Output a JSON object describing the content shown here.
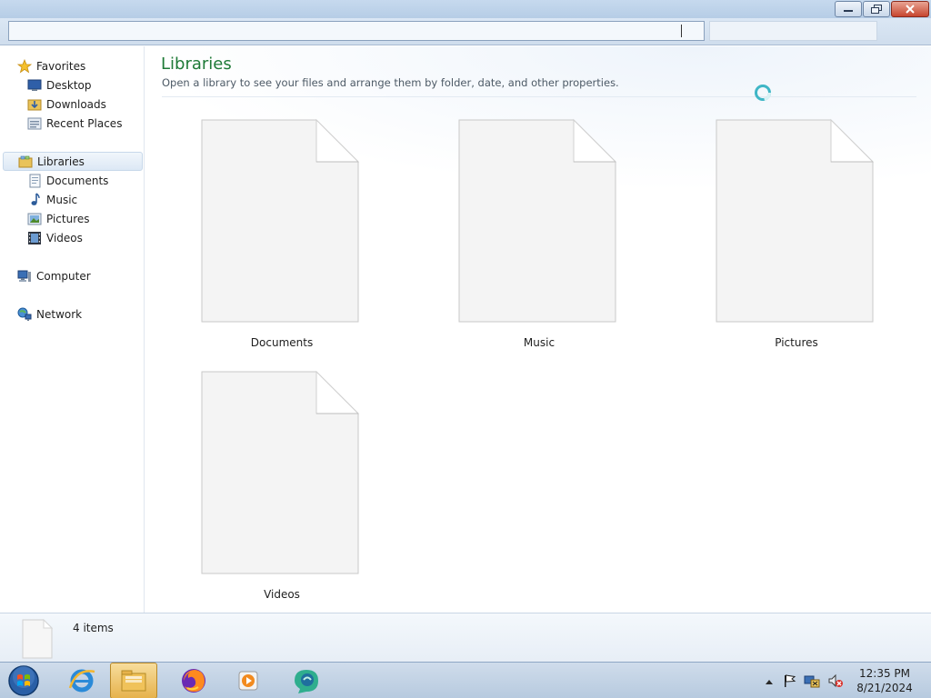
{
  "sidebar": {
    "favorites": {
      "label": "Favorites",
      "items": [
        "Desktop",
        "Downloads",
        "Recent Places"
      ]
    },
    "libraries": {
      "label": "Libraries",
      "items": [
        "Documents",
        "Music",
        "Pictures",
        "Videos"
      ]
    },
    "computer": {
      "label": "Computer"
    },
    "network": {
      "label": "Network"
    }
  },
  "main": {
    "title": "Libraries",
    "subtitle": "Open a library to see your files and arrange them by folder, date, and other properties.",
    "libraries": [
      {
        "label": "Documents"
      },
      {
        "label": "Music"
      },
      {
        "label": "Pictures"
      },
      {
        "label": "Videos"
      }
    ]
  },
  "details": {
    "count": "4 items"
  },
  "taskbar": {
    "apps": [
      "start-orb",
      "internet-explorer",
      "windows-explorer",
      "firefox",
      "media-player",
      "app"
    ],
    "clock": {
      "time": "12:35 PM",
      "date": "8/21/2024"
    }
  },
  "colors": {
    "title_green": "#1e7a37",
    "selection": "#dce8f5",
    "taskbar": "#b7cadf"
  }
}
